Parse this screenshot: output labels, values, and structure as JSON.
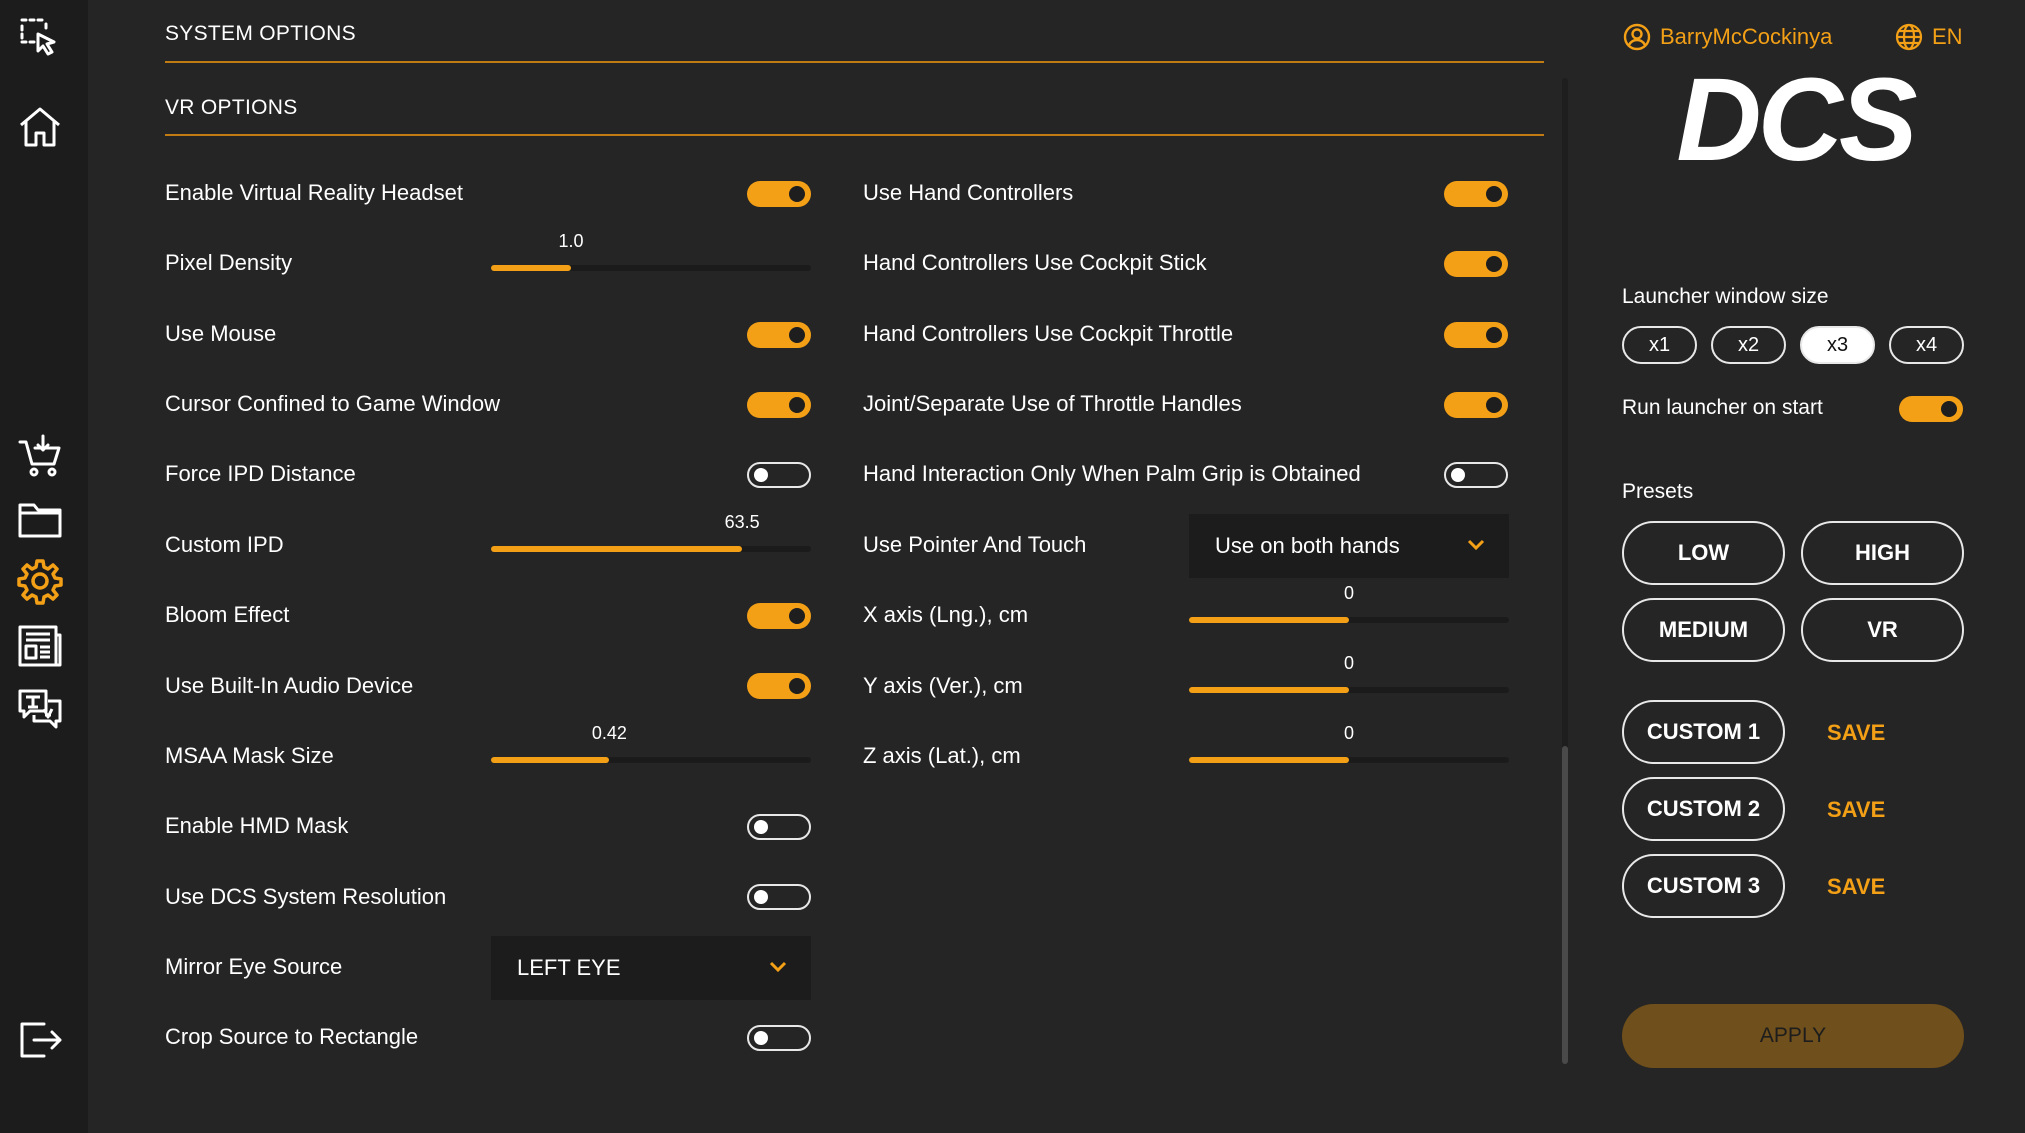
{
  "sidebar": {
    "icons": [
      "select-area-icon",
      "home-icon",
      "download-cart-icon",
      "folder-icon",
      "settings-icon",
      "news-icon",
      "chat-translate-icon",
      "logout-icon"
    ]
  },
  "sections": {
    "system_options": "SYSTEM OPTIONS",
    "vr_options": "VR OPTIONS"
  },
  "left_column": {
    "enable_vr": "Enable Virtual Reality Headset",
    "pixel_density": "Pixel Density",
    "pixel_density_value": "1.0",
    "pixel_density_fraction": 0.25,
    "use_mouse": "Use Mouse",
    "cursor_confined": "Cursor Confined to Game Window",
    "force_ipd": "Force IPD Distance",
    "custom_ipd": "Custom IPD",
    "custom_ipd_value": "63.5",
    "custom_ipd_fraction": 0.785,
    "bloom": "Bloom Effect",
    "builtin_audio": "Use Built-In Audio Device",
    "msaa_mask": "MSAA Mask Size",
    "msaa_mask_value": "0.42",
    "msaa_mask_fraction": 0.37,
    "hmd_mask": "Enable HMD Mask",
    "dcs_resolution": "Use DCS System Resolution",
    "mirror_eye": "Mirror Eye Source",
    "mirror_eye_value": "LEFT EYE",
    "crop_source": "Crop Source to Rectangle"
  },
  "right_column": {
    "hand_controllers": "Use Hand Controllers",
    "cockpit_stick": "Hand Controllers Use Cockpit Stick",
    "cockpit_throttle": "Hand Controllers Use Cockpit Throttle",
    "throttle_handles": "Joint/Separate Use of Throttle Handles",
    "palm_grip": "Hand Interaction Only When Palm Grip is Obtained",
    "pointer_touch": "Use Pointer And Touch",
    "pointer_touch_value": "Use on both hands",
    "x_axis": "X axis (Lng.), cm",
    "x_axis_value": "0",
    "y_axis": "Y axis (Ver.), cm",
    "y_axis_value": "0",
    "z_axis": "Z axis (Lat.), cm",
    "z_axis_value": "0",
    "axis_fraction": 0.5
  },
  "toggles": {
    "enable_vr": true,
    "use_mouse": true,
    "cursor_confined": true,
    "force_ipd": false,
    "bloom": true,
    "builtin_audio": true,
    "hmd_mask": false,
    "dcs_resolution": false,
    "crop_source": false,
    "hand_controllers": true,
    "cockpit_stick": true,
    "cockpit_throttle": true,
    "throttle_handles": true,
    "palm_grip": false,
    "run_on_start": true
  },
  "panel": {
    "username": "BarryMcCockinya",
    "language": "EN",
    "logo_text": "DCS",
    "window_size_label": "Launcher window size",
    "sizes": [
      "x1",
      "x2",
      "x3",
      "x4"
    ],
    "active_size": "x3",
    "run_on_start": "Run launcher on start",
    "presets_label": "Presets",
    "presets": [
      "LOW",
      "HIGH",
      "MEDIUM",
      "VR"
    ],
    "custom": [
      "CUSTOM 1",
      "CUSTOM 2",
      "CUSTOM 3"
    ],
    "save_label": "SAVE",
    "apply_label": "APPLY"
  },
  "colors": {
    "accent": "#f3a016",
    "background": "#252525",
    "rail": "#1c1c1c",
    "apply_button": "#6f4f1b"
  }
}
